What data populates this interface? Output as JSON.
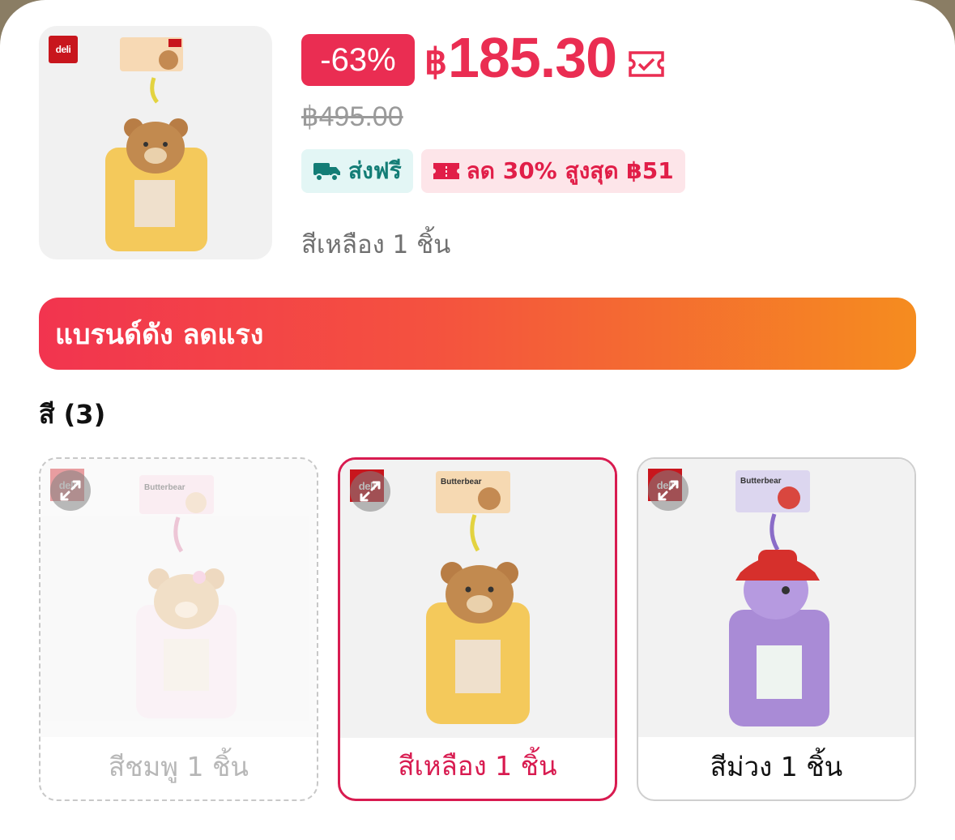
{
  "product": {
    "discount": "-63%",
    "price_currency": "฿",
    "price_value": "185.30",
    "original_price": "฿495.00",
    "brand_logo": "deli",
    "selected_variant": "สีเหลือง 1 ชิ้น"
  },
  "tags": {
    "shipping": "ส่งฟรี",
    "coupon": "ลด 30% สูงสุด ฿51"
  },
  "banner": {
    "text": "แบรนด์ดัง ลดแรง"
  },
  "variants": {
    "heading": "สี (3)",
    "items": [
      {
        "label": "สีชมพู 1 ชิ้น",
        "state": "unavailable",
        "color": "#f7e7ee"
      },
      {
        "label": "สีเหลือง 1 ชิ้น",
        "state": "selected",
        "color": "#f4c95b"
      },
      {
        "label": "สีม่วง 1 ชิ้น",
        "state": "available",
        "color": "#a98bd6"
      }
    ]
  },
  "packaging": {
    "brand_text": "Butterbear"
  },
  "colors": {
    "accent": "#ea2d52",
    "ship_tag": "#137d76",
    "banner_start": "#f2344f",
    "banner_end": "#f58c1f"
  },
  "icons": [
    "voucher-check-icon",
    "truck-icon",
    "ticket-icon",
    "expand-icon"
  ]
}
